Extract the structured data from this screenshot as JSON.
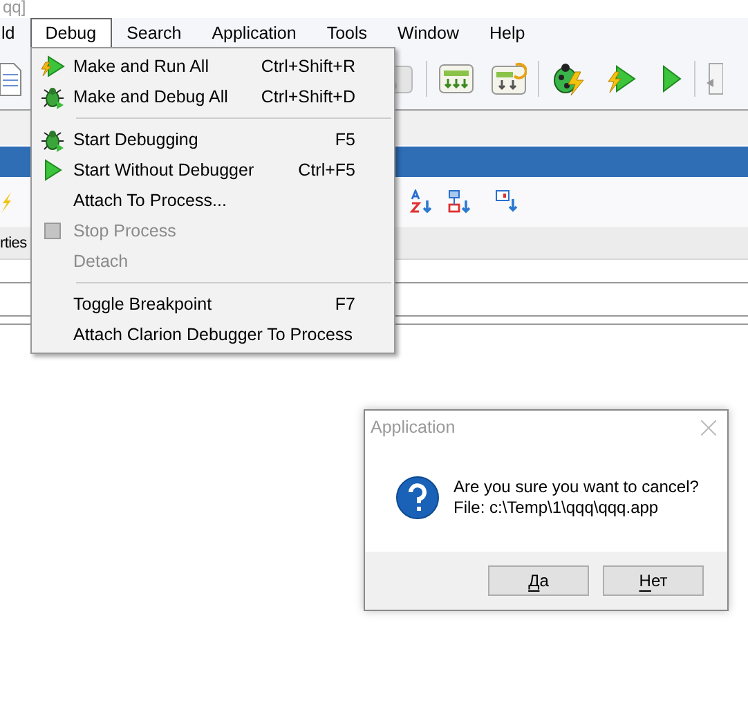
{
  "window": {
    "title": "qq]"
  },
  "menu_bar": [
    {
      "label": "ld",
      "selected": false
    },
    {
      "label": "Debug",
      "selected": true
    },
    {
      "label": "Search",
      "selected": false
    },
    {
      "label": "Application",
      "selected": false
    },
    {
      "label": "Tools",
      "selected": false
    },
    {
      "label": "Window",
      "selected": false
    },
    {
      "label": "Help",
      "selected": false
    }
  ],
  "panel_tab": {
    "label": "rties"
  },
  "debug_menu": {
    "items": [
      {
        "kind": "run",
        "label": "Make and Run All",
        "shortcut": "Ctrl+Shift+R",
        "disabled": false
      },
      {
        "kind": "bug",
        "label": "Make and Debug All",
        "shortcut": "Ctrl+Shift+D",
        "disabled": false
      },
      {
        "kind": "separator"
      },
      {
        "kind": "bug",
        "label": "Start Debugging",
        "shortcut": "F5",
        "disabled": false
      },
      {
        "kind": "play",
        "label": "Start Without Debugger",
        "shortcut": "Ctrl+F5",
        "disabled": false
      },
      {
        "kind": "plain",
        "label": "Attach To Process...",
        "disabled": false
      },
      {
        "kind": "stop",
        "label": "Stop Process",
        "disabled": true
      },
      {
        "kind": "plain",
        "label": "Detach",
        "disabled": true
      },
      {
        "kind": "separator"
      },
      {
        "kind": "plain",
        "label": "Toggle Breakpoint",
        "shortcut": "F7",
        "disabled": false
      },
      {
        "kind": "plain",
        "label": "Attach Clarion Debugger To Process",
        "disabled": false
      }
    ]
  },
  "dialog": {
    "title": "Application",
    "message_lines": [
      "Are you sure you want to cancel?",
      "File: c:\\Temp\\1\\qqq\\qqq.app"
    ],
    "buttons": [
      {
        "label": "Да",
        "mnemonic_underlined": true
      },
      {
        "label": "Нет",
        "mnemonic_underlined": true
      }
    ]
  }
}
